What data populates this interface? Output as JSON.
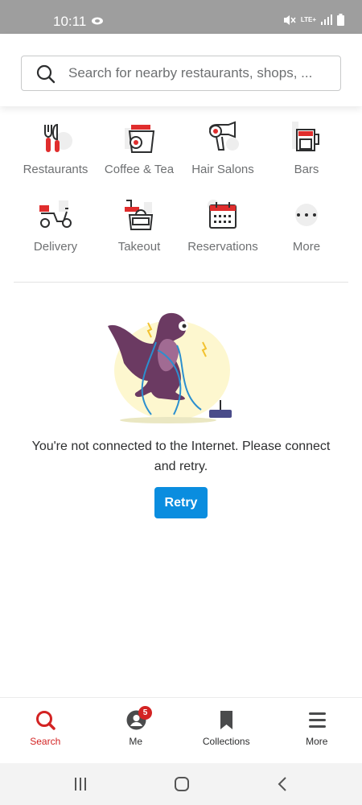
{
  "status_bar": {
    "time": "10:11",
    "network": "LTE+",
    "icons": [
      "cloud-icon",
      "mute-icon",
      "lte-icon",
      "signal-icon",
      "battery-icon"
    ]
  },
  "search": {
    "placeholder": "Search for nearby restaurants, shops, ...",
    "value": ""
  },
  "categories": [
    {
      "label": "Restaurants",
      "icon": "fork-knife-icon"
    },
    {
      "label": "Coffee & Tea",
      "icon": "coffee-cup-icon"
    },
    {
      "label": "Hair Salons",
      "icon": "hair-dryer-icon"
    },
    {
      "label": "Bars",
      "icon": "beer-mug-icon"
    },
    {
      "label": "Delivery",
      "icon": "scooter-icon"
    },
    {
      "label": "Takeout",
      "icon": "takeout-box-icon"
    },
    {
      "label": "Reservations",
      "icon": "calendar-icon"
    },
    {
      "label": "More",
      "icon": "ellipsis-icon"
    }
  ],
  "offline": {
    "message": "You're not connected to the Internet. Please connect and retry.",
    "retry_label": "Retry",
    "illustration": "dinosaur-unplugged-illustration"
  },
  "bottom_nav": {
    "items": [
      {
        "label": "Search",
        "icon": "search-icon",
        "active": true
      },
      {
        "label": "Me",
        "icon": "profile-icon",
        "badge": "5"
      },
      {
        "label": "Collections",
        "icon": "bookmark-icon"
      },
      {
        "label": "More",
        "icon": "menu-icon"
      }
    ]
  },
  "system_nav": {
    "buttons": [
      "recent-apps-icon",
      "home-icon",
      "back-icon"
    ]
  },
  "colors": {
    "brand_red": "#d32323",
    "retry_blue": "#0a8ddf",
    "status_bar": "#9e9e9e",
    "text": "#2d2e2f",
    "muted_text": "#6e7072"
  }
}
